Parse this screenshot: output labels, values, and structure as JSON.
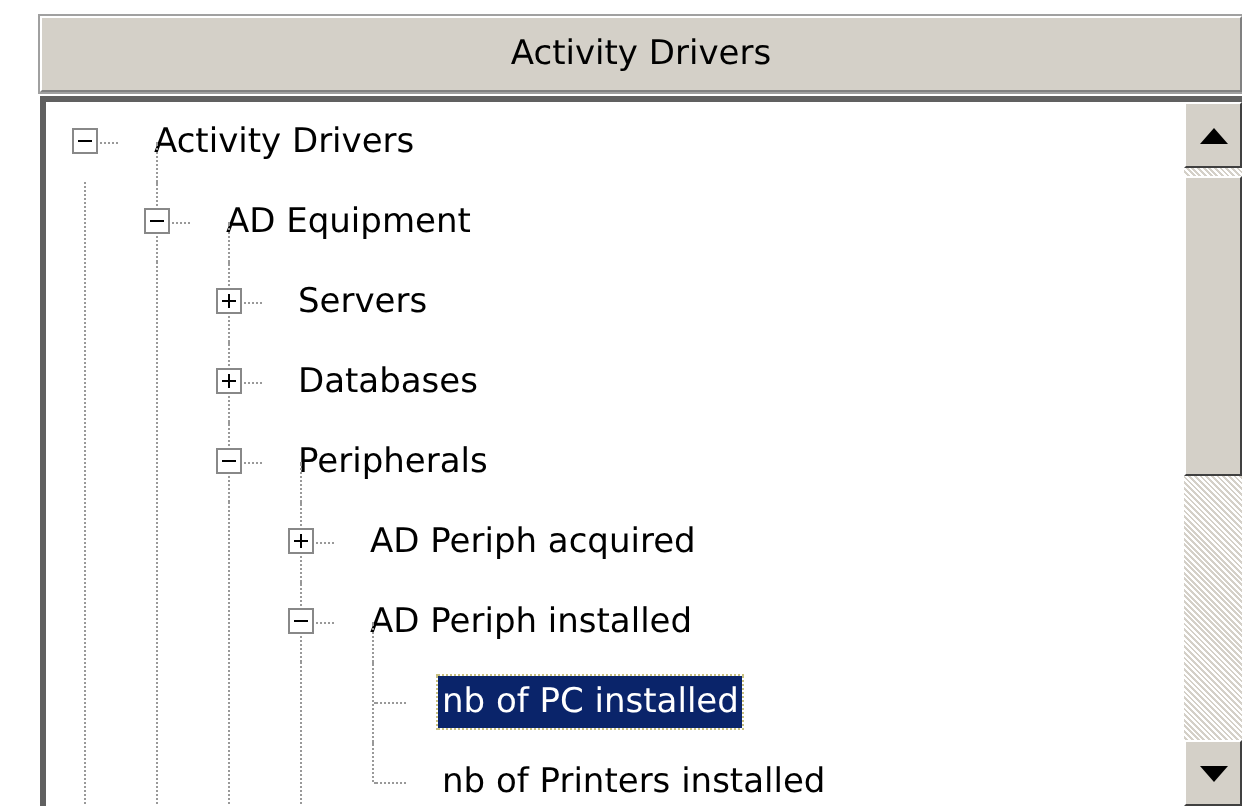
{
  "header": {
    "title": "Activity Drivers"
  },
  "tree": [
    {
      "label": "Activity Drivers",
      "kind": "branch",
      "expanded": true,
      "selected": false,
      "children": [
        {
          "label": "AD Equipment",
          "kind": "branch",
          "expanded": true,
          "selected": false,
          "children": [
            {
              "label": "Servers",
              "kind": "branch",
              "expanded": false,
              "selected": false
            },
            {
              "label": "Databases",
              "kind": "branch",
              "expanded": false,
              "selected": false
            },
            {
              "label": "Peripherals",
              "kind": "branch",
              "expanded": true,
              "selected": false,
              "children": [
                {
                  "label": "AD Periph acquired",
                  "kind": "branch",
                  "expanded": false,
                  "selected": false
                },
                {
                  "label": "AD Periph installed",
                  "kind": "branch",
                  "expanded": true,
                  "selected": false,
                  "children": [
                    {
                      "label": "nb of PC installed",
                      "kind": "leaf",
                      "selected": true
                    },
                    {
                      "label": "nb of Printers installed",
                      "kind": "leaf",
                      "selected": false
                    }
                  ]
                }
              ]
            }
          ]
        }
      ]
    }
  ]
}
